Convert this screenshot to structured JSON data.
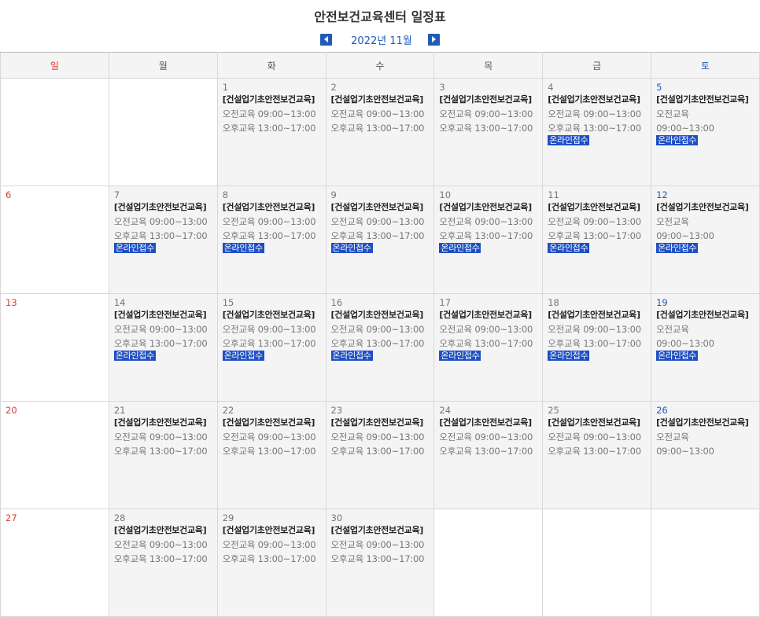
{
  "page": {
    "title": "안전보건교육센터 일정표",
    "month_label": "2022년 11월"
  },
  "weekdays": [
    "일",
    "월",
    "화",
    "수",
    "목",
    "금",
    "토"
  ],
  "labels": {
    "course": "[건설업기초안전보건교육]",
    "am": "오전교육 09:00~13:00",
    "pm": "오후교육 13:00~17:00",
    "sat_am_1": "오전교육",
    "sat_am_2": "09:00~13:00",
    "online": "온라인접수"
  },
  "weeks": [
    [
      {
        "day": "",
        "type": "empty"
      },
      {
        "day": "",
        "type": "empty"
      },
      {
        "day": "1",
        "type": "weekday",
        "online": false
      },
      {
        "day": "2",
        "type": "weekday",
        "online": false
      },
      {
        "day": "3",
        "type": "weekday",
        "online": false
      },
      {
        "day": "4",
        "type": "weekday",
        "online": true
      },
      {
        "day": "5",
        "type": "sat",
        "online": true
      }
    ],
    [
      {
        "day": "6",
        "type": "sun"
      },
      {
        "day": "7",
        "type": "weekday",
        "online": true
      },
      {
        "day": "8",
        "type": "weekday",
        "online": true
      },
      {
        "day": "9",
        "type": "weekday",
        "online": true
      },
      {
        "day": "10",
        "type": "weekday",
        "online": true
      },
      {
        "day": "11",
        "type": "weekday",
        "online": true
      },
      {
        "day": "12",
        "type": "sat",
        "online": true
      }
    ],
    [
      {
        "day": "13",
        "type": "sun"
      },
      {
        "day": "14",
        "type": "weekday",
        "online": true
      },
      {
        "day": "15",
        "type": "weekday",
        "online": true
      },
      {
        "day": "16",
        "type": "weekday",
        "online": true
      },
      {
        "day": "17",
        "type": "weekday",
        "online": true
      },
      {
        "day": "18",
        "type": "weekday",
        "online": true
      },
      {
        "day": "19",
        "type": "sat",
        "online": true
      }
    ],
    [
      {
        "day": "20",
        "type": "sun"
      },
      {
        "day": "21",
        "type": "weekday",
        "online": false
      },
      {
        "day": "22",
        "type": "weekday",
        "online": false
      },
      {
        "day": "23",
        "type": "weekday",
        "online": false
      },
      {
        "day": "24",
        "type": "weekday",
        "online": false
      },
      {
        "day": "25",
        "type": "weekday",
        "online": false
      },
      {
        "day": "26",
        "type": "sat",
        "online": false
      }
    ],
    [
      {
        "day": "27",
        "type": "sun"
      },
      {
        "day": "28",
        "type": "weekday",
        "online": false
      },
      {
        "day": "29",
        "type": "weekday",
        "online": false
      },
      {
        "day": "30",
        "type": "weekday",
        "online": false
      },
      {
        "day": "",
        "type": "empty"
      },
      {
        "day": "",
        "type": "empty"
      },
      {
        "day": "",
        "type": "empty"
      }
    ]
  ],
  "colors": {
    "sunday": "#e23b2e",
    "saturday": "#1e5bb8",
    "badge": "#1e4fc4",
    "cell_bg": "#f4f4f4"
  }
}
